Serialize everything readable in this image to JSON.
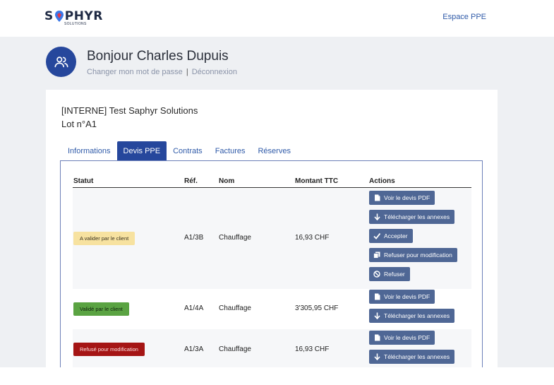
{
  "header": {
    "logo": {
      "main": "SAPHYR",
      "sub": "SOLUTIONS"
    },
    "nav_link": "Espace PPE"
  },
  "user": {
    "greeting": "Bonjour Charles Dupuis",
    "change_password": "Changer mon mot de passe",
    "separator": "|",
    "logout": "Déconnexion"
  },
  "project": {
    "title": "[INTERNE] Test Saphyr Solutions",
    "lot": "Lot n°A1"
  },
  "tabs": [
    {
      "label": "Informations",
      "active": false
    },
    {
      "label": "Devis PPE",
      "active": true
    },
    {
      "label": "Contrats",
      "active": false
    },
    {
      "label": "Factures",
      "active": false
    },
    {
      "label": "Réserves",
      "active": false
    }
  ],
  "table": {
    "columns": [
      "Statut",
      "Réf.",
      "Nom",
      "Montant TTC",
      "Actions"
    ],
    "rows": [
      {
        "status": "A valider par le client",
        "status_color": "#f7e2a0",
        "ref": "A1/3B",
        "nom": "Chauffage",
        "montant": "16,93 CHF",
        "actions": [
          "Voir le devis PDF",
          "Télécharger les annexes",
          "Accepter",
          "Refuser pour modification",
          "Refuser"
        ]
      },
      {
        "status": "Validé par le client",
        "status_color": "#5aa342",
        "ref": "A1/4A",
        "nom": "Chauffage",
        "montant": "3'305,95 CHF",
        "actions": [
          "Voir le devis PDF",
          "Télécharger les annexes"
        ]
      },
      {
        "status": "Refusé pour modification",
        "status_color": "#a51515",
        "ref": "A1/3A",
        "nom": "Chauffage",
        "montant": "16,93 CHF",
        "actions": [
          "Voir le devis PDF",
          "Télécharger les annexes"
        ]
      }
    ]
  },
  "colors": {
    "primary": "#26479c",
    "link": "#2f5aa8",
    "button": "#4f6795",
    "background": "#eef0f3"
  },
  "icons": {
    "avatar": "users-icon",
    "pdf": "file-icon",
    "download": "arrow-down-icon",
    "accept": "check-icon",
    "modify": "copy-icon",
    "refuse": "ban-icon"
  }
}
